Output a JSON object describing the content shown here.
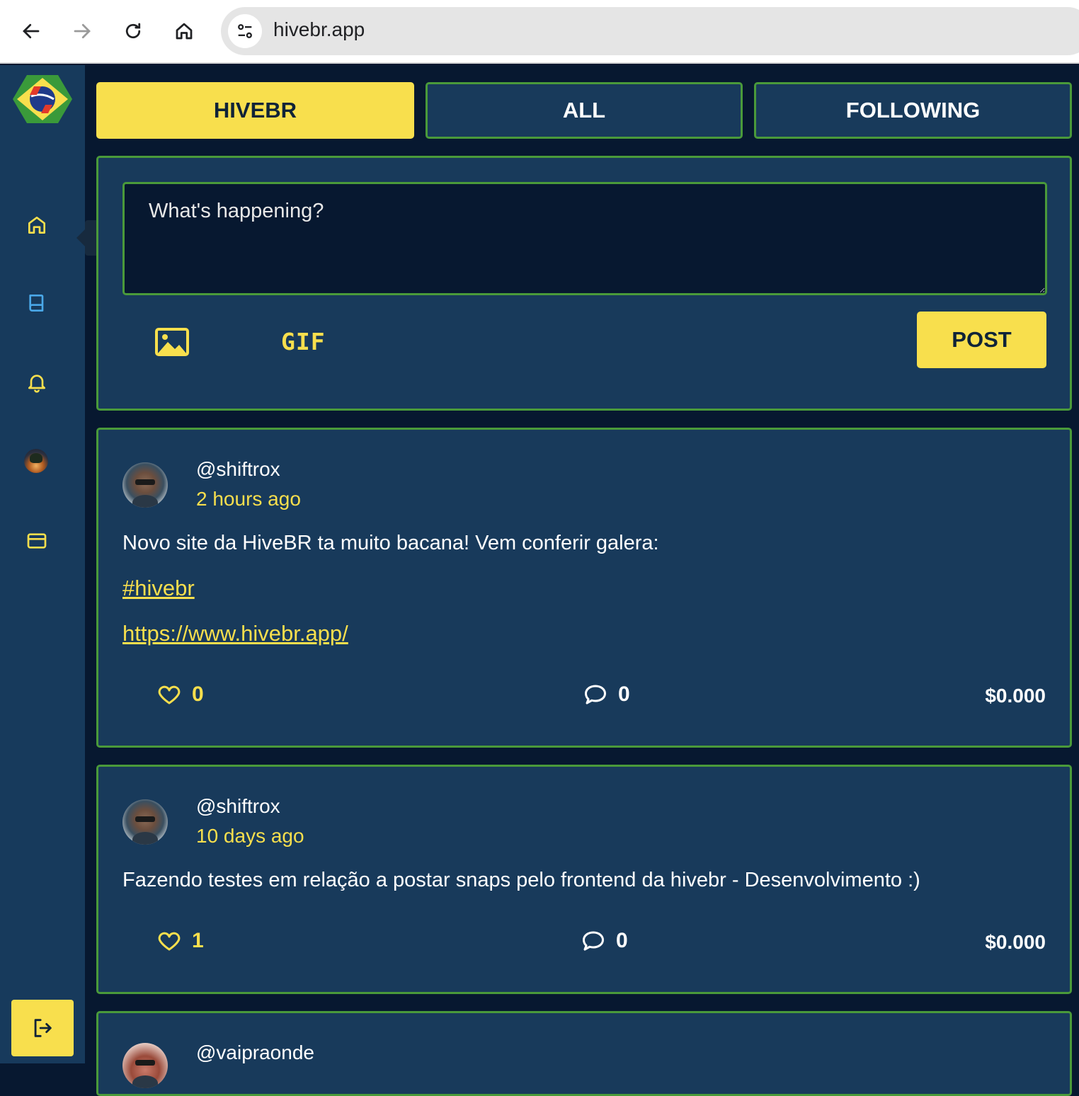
{
  "browser": {
    "url": "hivebr.app"
  },
  "sidebar": {
    "tooltip": "Blog"
  },
  "tabs": [
    {
      "label": "HIVEBR",
      "active": true
    },
    {
      "label": "ALL",
      "active": false
    },
    {
      "label": "FOLLOWING",
      "active": false
    }
  ],
  "composer": {
    "placeholder": "What's happening?",
    "gif_label": "GIF",
    "post_label": "POST"
  },
  "posts": [
    {
      "username": "@shiftrox",
      "time": "2 hours ago",
      "body": "Novo site da HiveBR ta muito bacana! Vem conferir galera:",
      "hashtag": "#hivebr",
      "link": "https://www.hivebr.app/",
      "likes": "0",
      "comments": "0",
      "payout": "$0.000"
    },
    {
      "username": "@shiftrox",
      "time": "10 days ago",
      "body": "Fazendo testes em relação a postar snaps pelo frontend da hivebr - Desenvolvimento :)",
      "likes": "1",
      "comments": "0",
      "payout": "$0.000"
    },
    {
      "username": "@vaipraonde"
    }
  ],
  "colors": {
    "accent": "#f8df4d",
    "panel": "#183a5b",
    "border": "#4a9a3a",
    "background": "#071830"
  }
}
